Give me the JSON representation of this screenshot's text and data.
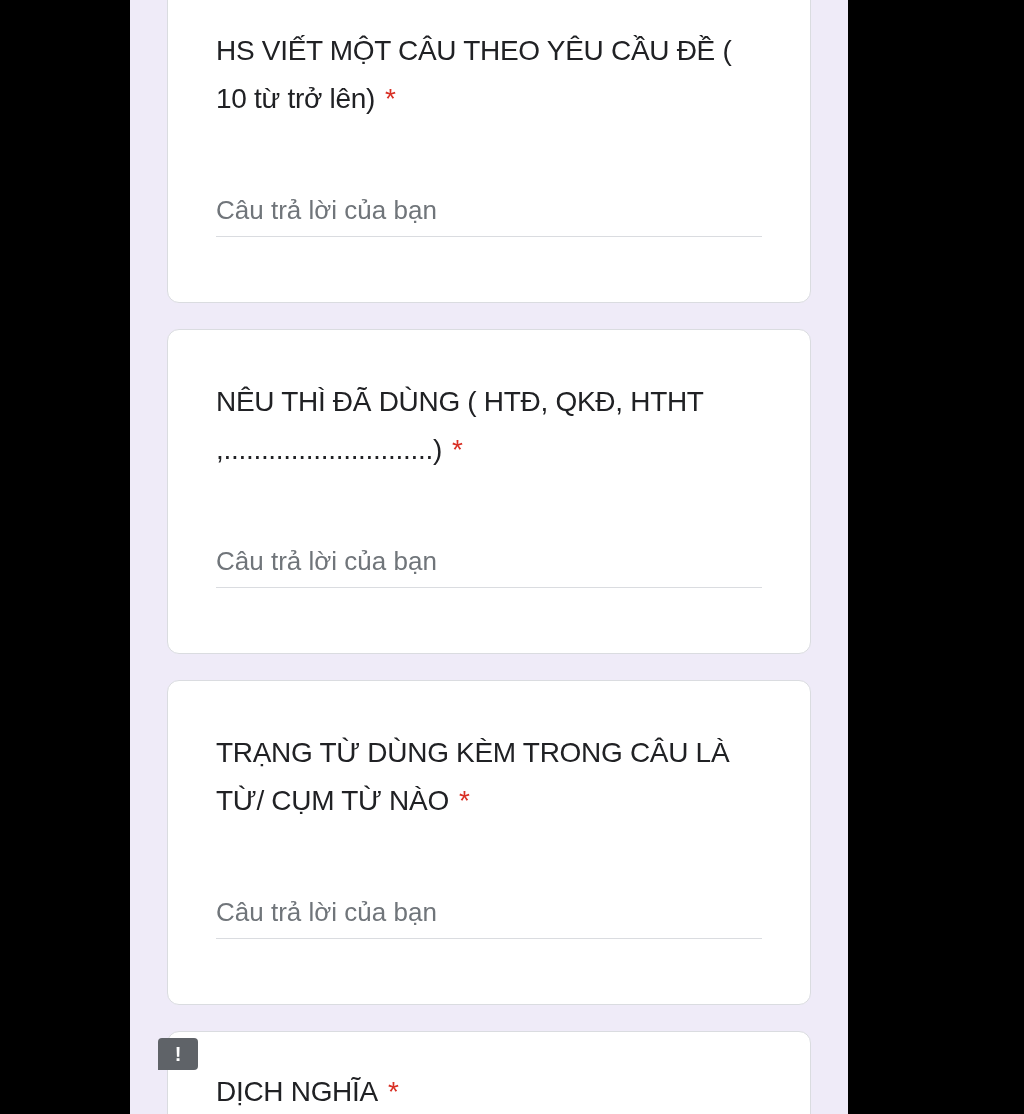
{
  "questions": [
    {
      "title": "HS VIẾT MỘT CÂU THEO YÊU CẦU ĐỀ ( 10 từ trở lên)",
      "required_mark": "*",
      "answer": {
        "placeholder": "Câu trả lời của bạn"
      }
    },
    {
      "title": "NÊU THÌ ĐÃ DÙNG ( HTĐ, QKĐ, HTHT ,............................)",
      "required_mark": "*",
      "answer": {
        "placeholder": "Câu trả lời của bạn"
      }
    },
    {
      "title": "TRẠNG TỪ DÙNG KÈM TRONG CÂU LÀ TỪ/ CỤM TỪ NÀO",
      "required_mark": "*",
      "answer": {
        "placeholder": "Câu trả lời của bạn"
      }
    },
    {
      "title": "DỊCH NGHĨA",
      "required_mark": "*"
    }
  ],
  "feedback_button": {
    "label": "!"
  }
}
